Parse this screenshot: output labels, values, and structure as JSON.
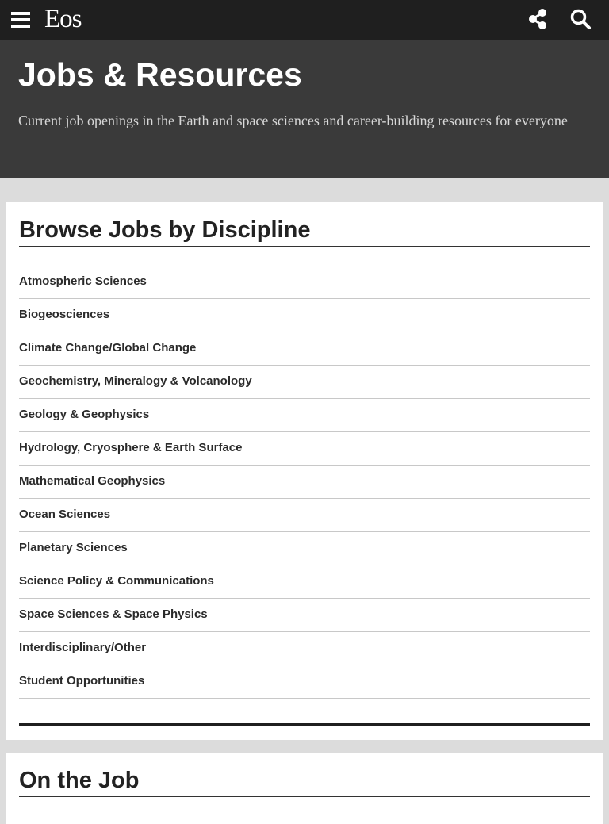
{
  "header": {
    "logo_text": "Eos",
    "menu_icon": "hamburger-menu-icon",
    "share_icon": "share-icon",
    "search_icon": "search-icon"
  },
  "hero": {
    "title": "Jobs & Resources",
    "subtitle": "Current job openings in the Earth and space sciences and career-building resources for everyone"
  },
  "browse": {
    "title": "Browse Jobs by Discipline",
    "disciplines": [
      "Atmospheric Sciences",
      "Biogeosciences",
      "Climate Change/Global Change",
      "Geochemistry, Mineralogy & Volcanology",
      "Geology & Geophysics",
      "Hydrology, Cryosphere & Earth Surface",
      "Mathematical Geophysics",
      "Ocean Sciences",
      "Planetary Sciences",
      "Science Policy & Communications",
      "Space Sciences & Space Physics",
      "Interdisciplinary/Other",
      "Student Opportunities"
    ]
  },
  "on_the_job": {
    "title": "On the Job"
  },
  "colors": {
    "topbar": "#1f1f1f",
    "hero": "#3a3a3a",
    "page_bg": "#dcdcdc",
    "card_bg": "#ffffff",
    "text": "#222222"
  }
}
